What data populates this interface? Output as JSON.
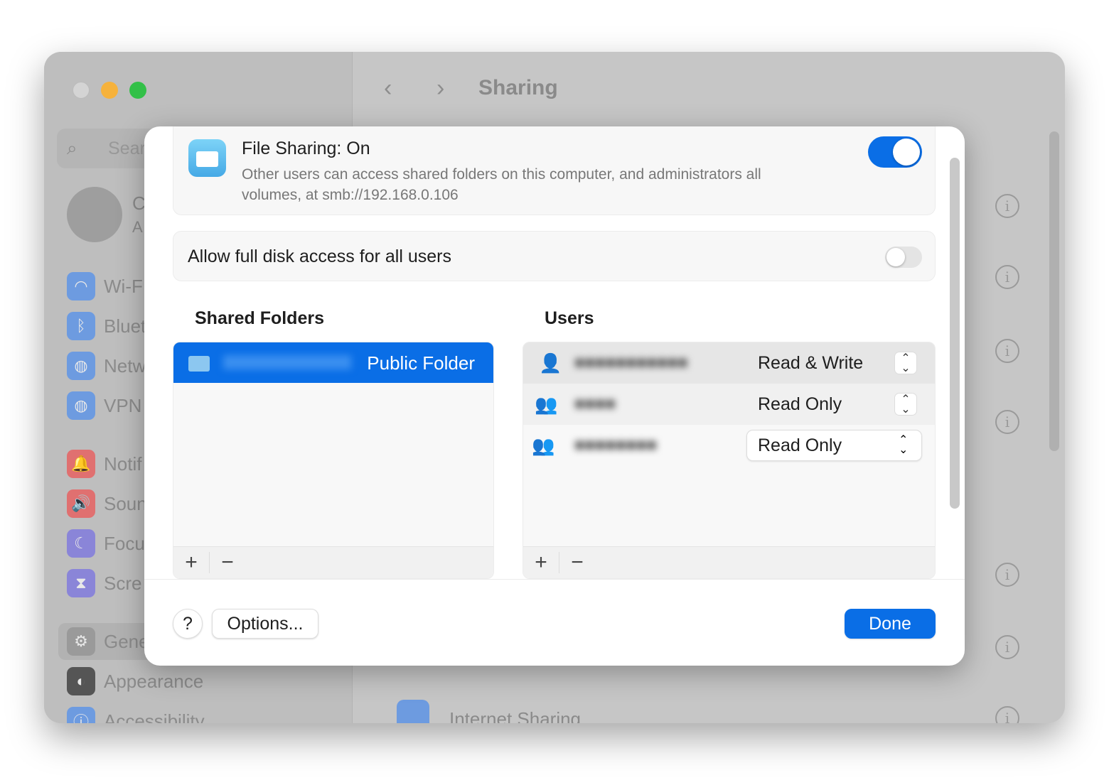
{
  "window": {
    "title": "Sharing",
    "colors": {
      "close": "#d4d4d4",
      "minimize": "#f6b23c",
      "zoom": "#33c048"
    }
  },
  "sidebar": {
    "search_placeholder": "Searc",
    "account": {
      "name": "C",
      "subtitle": "A"
    },
    "items": [
      {
        "label": "Wi-F",
        "icon": "wifi-icon",
        "color": "#6d9be0"
      },
      {
        "label": "Bluet",
        "icon": "bluetooth-icon",
        "color": "#6d9be0"
      },
      {
        "label": "Netw",
        "icon": "globe-icon",
        "color": "#6d9be0"
      },
      {
        "label": "VPN",
        "icon": "vpn-globe-icon",
        "color": "#6d9be0"
      },
      {
        "label": "Notif",
        "icon": "bell-icon",
        "color": "#e07070"
      },
      {
        "label": "Soun",
        "icon": "speaker-icon",
        "color": "#e07070"
      },
      {
        "label": "Focu",
        "icon": "moon-icon",
        "color": "#8a85d8"
      },
      {
        "label": "Scre",
        "icon": "hourglass-icon",
        "color": "#8a85d8"
      },
      {
        "label": "Gene",
        "icon": "gear-icon",
        "color": "#9a9a9a"
      },
      {
        "label": "Appearance",
        "icon": "appearance-icon",
        "color": "#555555"
      },
      {
        "label": "Accessibility",
        "icon": "accessibility-icon",
        "color": "#6d9be0"
      }
    ]
  },
  "main": {
    "internet_sharing": "Internet Sharing"
  },
  "dialog": {
    "file_sharing": {
      "title": "File Sharing: On",
      "description_line1": "Other users can access shared folders on this computer, and administrators all",
      "description_line2": "volumes, at smb://192.168.0.106",
      "enabled": true
    },
    "full_disk": {
      "label": "Allow full disk access for all users",
      "enabled": false
    },
    "shared_folders": {
      "heading": "Shared Folders",
      "items": [
        {
          "name": "Public Folder",
          "selected": true
        }
      ]
    },
    "users": {
      "heading": "Users",
      "items": [
        {
          "icon": "person-icon",
          "permission": "Read & Write"
        },
        {
          "icon": "group-icon",
          "permission": "Read Only"
        },
        {
          "icon": "everyone-icon",
          "permission": "Read Only"
        }
      ]
    },
    "add_label": "+",
    "remove_label": "−",
    "help_label": "?",
    "options_label": "Options...",
    "done_label": "Done",
    "accent": "#0a6ee6"
  }
}
